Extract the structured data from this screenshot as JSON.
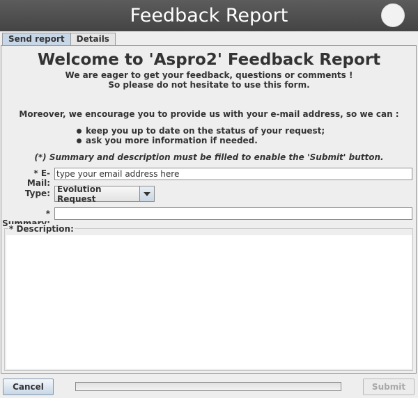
{
  "window": {
    "title": "Feedback Report"
  },
  "tabs": [
    {
      "label": "Send report",
      "selected": true
    },
    {
      "label": "Details",
      "selected": false
    }
  ],
  "intro": {
    "heading": "Welcome to 'Aspro2' Feedback Report",
    "line1": "We are eager to get your feedback, questions or comments !",
    "line2": "So please do not hesitate to use this form.",
    "moreover": "Moreover, we encourage you to provide us with your e-mail address, so we can :",
    "bullets": [
      "keep you up to date on the status of your request;",
      "ask you more information if needed."
    ],
    "note": "(*) Summary and description must be filled to enable the 'Submit' button."
  },
  "form": {
    "email_label": "* E-Mail:",
    "email_placeholder": "type your email address here",
    "email_value": "",
    "type_label": "Type:",
    "type_value": "Evolution Request",
    "summary_label": "* Summary:",
    "summary_value": "",
    "description_label": "* Description:",
    "description_value": ""
  },
  "footer": {
    "cancel_label": "Cancel",
    "submit_label": "Submit",
    "submit_enabled": false,
    "progress": 0
  }
}
